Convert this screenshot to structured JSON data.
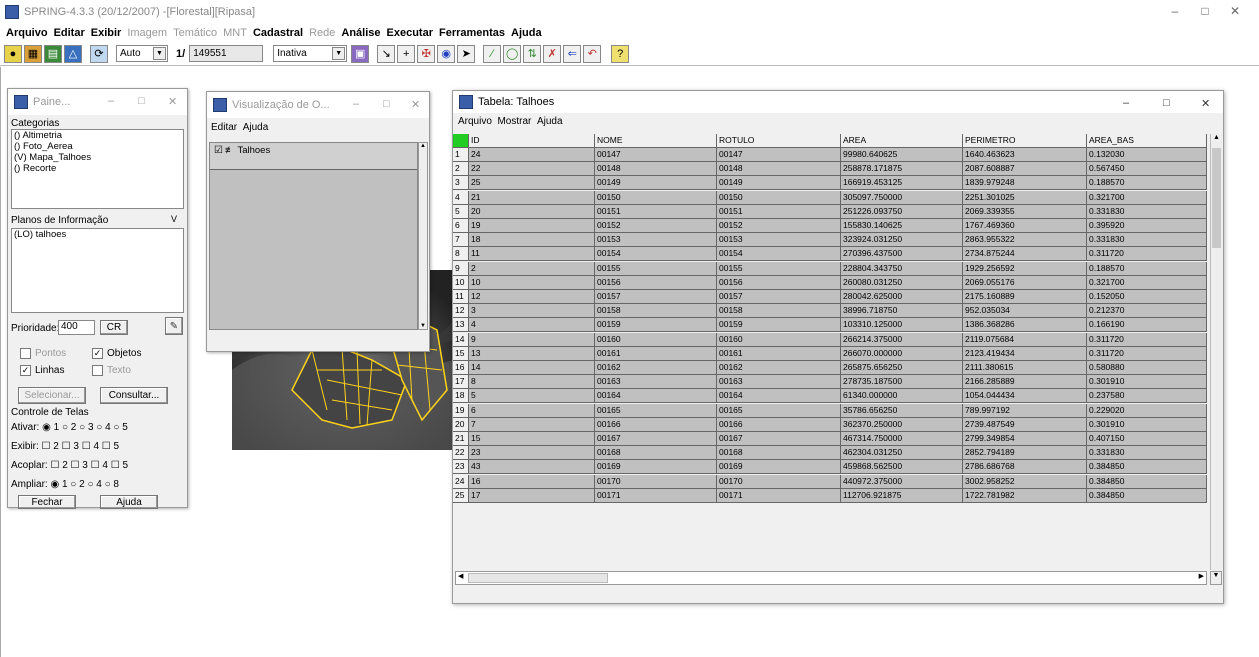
{
  "app": {
    "title": "SPRING-4.3.3 (20/12/2007) -[Florestal][Ripasa]",
    "menu": [
      {
        "label": "Arquivo",
        "enabled": true
      },
      {
        "label": "Editar",
        "enabled": true
      },
      {
        "label": "Exibir",
        "enabled": true
      },
      {
        "label": "Imagem",
        "enabled": false
      },
      {
        "label": "Temático",
        "enabled": false
      },
      {
        "label": "MNT",
        "enabled": false
      },
      {
        "label": "Cadastral",
        "enabled": true
      },
      {
        "label": "Rede",
        "enabled": false
      },
      {
        "label": "Análise",
        "enabled": true
      },
      {
        "label": "Executar",
        "enabled": true
      },
      {
        "label": "Ferramentas",
        "enabled": true
      },
      {
        "label": "Ajuda",
        "enabled": true
      }
    ],
    "toolbar": {
      "auto_value": "Auto",
      "scale_prefix": "1/",
      "scale_value": "149551",
      "mode_value": "Inativa"
    }
  },
  "panel": {
    "title": "Paine...",
    "categorias_label": "Categorias",
    "categorias": [
      "() Altimetria",
      "() Foto_Aerea",
      "(V) Mapa_Talhoes",
      "() Recorte"
    ],
    "planos_label": "Planos de Informação",
    "planos_btn": "V",
    "planos": [
      "(LO) talhoes"
    ],
    "prioridade_label": "Prioridade:",
    "prioridade_value": "400",
    "cr_label": "CR",
    "pontos": "Pontos",
    "objetos": "Objetos",
    "linhas": "Linhas",
    "texto": "Texto",
    "selecionar": "Selecionar...",
    "consultar": "Consultar...",
    "controle_label": "Controle de Telas",
    "ativar": "Ativar: ◉ 1  ○ 2  ○ 3  ○ 4  ○ 5",
    "exibir": "Exibir:     ☐ 2  ☐ 3  ☐ 4  ☐ 5",
    "acoplar": "Acoplar:    ☐ 2  ☐ 3  ☐ 4  ☐ 5",
    "ampliar": "Ampliar: ◉ 1   ○ 2   ○ 4   ○ 8",
    "fechar": "Fechar",
    "ajuda": "Ajuda"
  },
  "viz": {
    "title": "Visualização de O...",
    "menu": [
      "Editar",
      "Ajuda"
    ],
    "item": "Talhoes"
  },
  "table": {
    "title": "Tabela: Talhoes",
    "menu": [
      "Arquivo",
      "Mostrar",
      "Ajuda"
    ],
    "columns": [
      "ID",
      "NOME",
      "ROTULO",
      "AREA",
      "PERIMETRO",
      "AREA_BAS"
    ],
    "rows": [
      [
        "1",
        "24",
        "00147",
        "00147",
        "99980.640625",
        "1640.463623",
        "0.132030"
      ],
      [
        "2",
        "22",
        "00148",
        "00148",
        "258878.171875",
        "2087.608887",
        "0.567450"
      ],
      [
        "3",
        "25",
        "00149",
        "00149",
        "166919.453125",
        "1839.979248",
        "0.188570"
      ],
      [
        "4",
        "21",
        "00150",
        "00150",
        "305097.750000",
        "2251.301025",
        "0.321700"
      ],
      [
        "5",
        "20",
        "00151",
        "00151",
        "251226.093750",
        "2069.339355",
        "0.331830"
      ],
      [
        "6",
        "19",
        "00152",
        "00152",
        "155830.140625",
        "1767.469360",
        "0.395920"
      ],
      [
        "7",
        "18",
        "00153",
        "00153",
        "323924.031250",
        "2863.955322",
        "0.331830"
      ],
      [
        "8",
        "11",
        "00154",
        "00154",
        "270396.437500",
        "2734.875244",
        "0.311720"
      ],
      [
        "9",
        "2",
        "00155",
        "00155",
        "228804.343750",
        "1929.256592",
        "0.188570"
      ],
      [
        "10",
        "10",
        "00156",
        "00156",
        "260080.031250",
        "2069.055176",
        "0.321700"
      ],
      [
        "11",
        "12",
        "00157",
        "00157",
        "280042.625000",
        "2175.160889",
        "0.152050"
      ],
      [
        "12",
        "3",
        "00158",
        "00158",
        "38996.718750",
        "952.035034",
        "0.212370"
      ],
      [
        "13",
        "4",
        "00159",
        "00159",
        "103310.125000",
        "1386.368286",
        "0.166190"
      ],
      [
        "14",
        "9",
        "00160",
        "00160",
        "266214.375000",
        "2119.075684",
        "0.311720"
      ],
      [
        "15",
        "13",
        "00161",
        "00161",
        "266070.000000",
        "2123.419434",
        "0.311720"
      ],
      [
        "16",
        "14",
        "00162",
        "00162",
        "265875.656250",
        "2111.380615",
        "0.580880"
      ],
      [
        "17",
        "8",
        "00163",
        "00163",
        "278735.187500",
        "2166.285889",
        "0.301910"
      ],
      [
        "18",
        "5",
        "00164",
        "00164",
        "61340.000000",
        "1054.044434",
        "0.237580"
      ],
      [
        "19",
        "6",
        "00165",
        "00165",
        "35786.656250",
        "789.997192",
        "0.229020"
      ],
      [
        "20",
        "7",
        "00166",
        "00166",
        "362370.250000",
        "2739.487549",
        "0.301910"
      ],
      [
        "21",
        "15",
        "00167",
        "00167",
        "467314.750000",
        "2799.349854",
        "0.407150"
      ],
      [
        "22",
        "23",
        "00168",
        "00168",
        "462304.031250",
        "2852.794189",
        "0.331830"
      ],
      [
        "23",
        "43",
        "00169",
        "00169",
        "459868.562500",
        "2786.686768",
        "0.384850"
      ],
      [
        "24",
        "16",
        "00170",
        "00170",
        "440972.375000",
        "3002.958252",
        "0.384850"
      ],
      [
        "25",
        "17",
        "00171",
        "00171",
        "112706.921875",
        "1722.781982",
        "0.384850"
      ]
    ]
  },
  "colors": {
    "selection_green": "#22cc22",
    "data_cell": "#c0c0c0",
    "polygon_outline": "#ffd21a"
  }
}
